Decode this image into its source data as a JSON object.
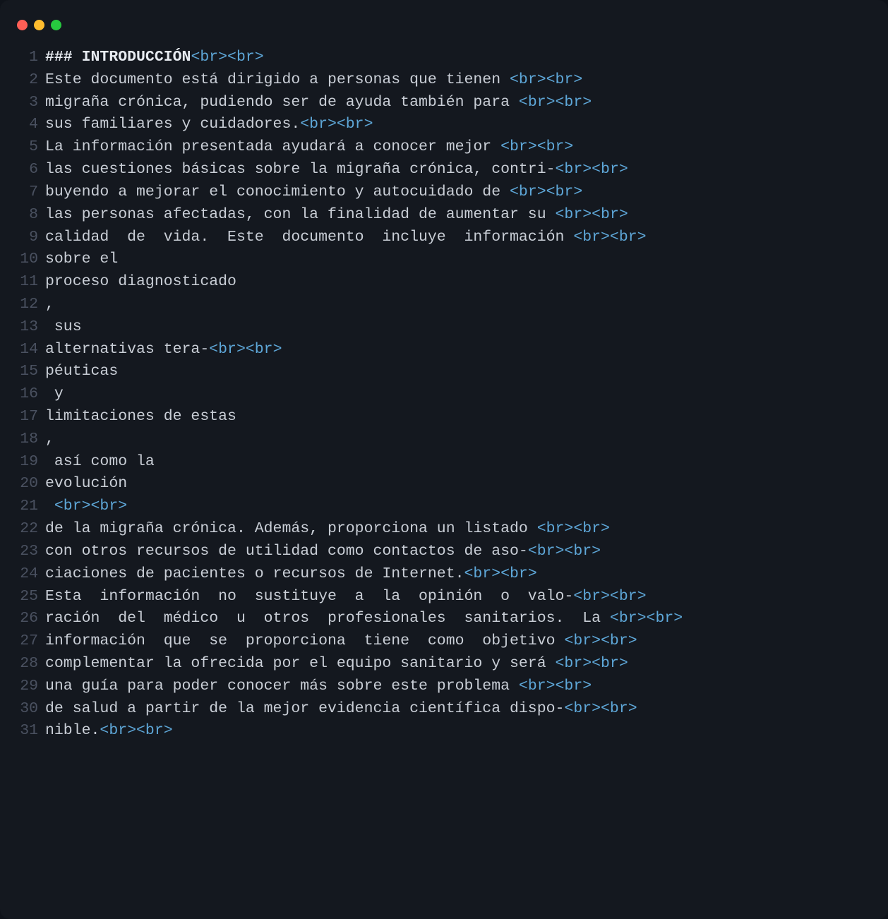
{
  "colors": {
    "bg": "#14181f",
    "outer_bg": "#0f131a",
    "text": "#c9ced6",
    "bold": "#e7ebf1",
    "tag": "#5ea7d8",
    "gutter": "#4a5160",
    "traffic_red": "#ff5f56",
    "traffic_yellow": "#ffbd2e",
    "traffic_green": "#27c93f"
  },
  "lines": [
    {
      "n": "1",
      "segs": [
        {
          "cls": "bold",
          "t": "### INTRODUCCIÓN"
        },
        {
          "cls": "tag",
          "t": "<br><br>"
        }
      ]
    },
    {
      "n": "2",
      "segs": [
        {
          "cls": "plain",
          "t": "Este documento está dirigido a personas que tienen "
        },
        {
          "cls": "tag",
          "t": "<br><br>"
        }
      ]
    },
    {
      "n": "3",
      "segs": [
        {
          "cls": "plain",
          "t": "migraña crónica, pudiendo ser de ayuda también para "
        },
        {
          "cls": "tag",
          "t": "<br><br>"
        }
      ]
    },
    {
      "n": "4",
      "segs": [
        {
          "cls": "plain",
          "t": "sus familiares y cuidadores."
        },
        {
          "cls": "tag",
          "t": "<br><br>"
        }
      ]
    },
    {
      "n": "5",
      "segs": [
        {
          "cls": "plain",
          "t": "La información presentada ayudará a conocer mejor "
        },
        {
          "cls": "tag",
          "t": "<br><br>"
        }
      ]
    },
    {
      "n": "6",
      "segs": [
        {
          "cls": "plain",
          "t": "las cuestiones básicas sobre la migraña crónica, contri-"
        },
        {
          "cls": "tag",
          "t": "<br><br>"
        }
      ]
    },
    {
      "n": "7",
      "segs": [
        {
          "cls": "plain",
          "t": "buyendo a mejorar el conocimiento y autocuidado de "
        },
        {
          "cls": "tag",
          "t": "<br><br>"
        }
      ]
    },
    {
      "n": "8",
      "segs": [
        {
          "cls": "plain",
          "t": "las personas afectadas, con la finalidad de aumentar su "
        },
        {
          "cls": "tag",
          "t": "<br><br>"
        }
      ]
    },
    {
      "n": "9",
      "segs": [
        {
          "cls": "plain",
          "t": "calidad  de  vida.  Este  documento  incluye  información "
        },
        {
          "cls": "tag",
          "t": "<br><br>"
        }
      ]
    },
    {
      "n": "10",
      "segs": [
        {
          "cls": "plain",
          "t": "sobre el"
        }
      ]
    },
    {
      "n": "11",
      "segs": [
        {
          "cls": "plain",
          "t": "proceso diagnosticado"
        }
      ]
    },
    {
      "n": "12",
      "segs": [
        {
          "cls": "plain",
          "t": ","
        }
      ]
    },
    {
      "n": "13",
      "segs": [
        {
          "cls": "plain",
          "t": " sus"
        }
      ]
    },
    {
      "n": "14",
      "segs": [
        {
          "cls": "plain",
          "t": "alternativas tera-"
        },
        {
          "cls": "tag",
          "t": "<br><br>"
        }
      ]
    },
    {
      "n": "15",
      "segs": [
        {
          "cls": "plain",
          "t": "péuticas"
        }
      ]
    },
    {
      "n": "16",
      "segs": [
        {
          "cls": "plain",
          "t": " y"
        }
      ]
    },
    {
      "n": "17",
      "segs": [
        {
          "cls": "plain",
          "t": "limitaciones de estas"
        }
      ]
    },
    {
      "n": "18",
      "segs": [
        {
          "cls": "plain",
          "t": ","
        }
      ]
    },
    {
      "n": "19",
      "segs": [
        {
          "cls": "plain",
          "t": " así como la"
        }
      ]
    },
    {
      "n": "20",
      "segs": [
        {
          "cls": "plain",
          "t": "evolución"
        }
      ]
    },
    {
      "n": "21",
      "segs": [
        {
          "cls": "plain",
          "t": " "
        },
        {
          "cls": "tag",
          "t": "<br><br>"
        }
      ]
    },
    {
      "n": "22",
      "segs": [
        {
          "cls": "plain",
          "t": "de la migraña crónica. Además, proporciona un listado "
        },
        {
          "cls": "tag",
          "t": "<br><br>"
        }
      ]
    },
    {
      "n": "23",
      "segs": [
        {
          "cls": "plain",
          "t": "con otros recursos de utilidad como contactos de aso-"
        },
        {
          "cls": "tag",
          "t": "<br><br>"
        }
      ]
    },
    {
      "n": "24",
      "segs": [
        {
          "cls": "plain",
          "t": "ciaciones de pacientes o recursos de Internet."
        },
        {
          "cls": "tag",
          "t": "<br><br>"
        }
      ]
    },
    {
      "n": "25",
      "segs": [
        {
          "cls": "plain",
          "t": "Esta  información  no  sustituye  a  la  opinión  o  valo-"
        },
        {
          "cls": "tag",
          "t": "<br><br>"
        }
      ]
    },
    {
      "n": "26",
      "segs": [
        {
          "cls": "plain",
          "t": "ración  del  médico  u  otros  profesionales  sanitarios.  La "
        },
        {
          "cls": "tag",
          "t": "<br><br>"
        }
      ]
    },
    {
      "n": "27",
      "segs": [
        {
          "cls": "plain",
          "t": "información  que  se  proporciona  tiene  como  objetivo "
        },
        {
          "cls": "tag",
          "t": "<br><br>"
        }
      ]
    },
    {
      "n": "28",
      "segs": [
        {
          "cls": "plain",
          "t": "complementar la ofrecida por el equipo sanitario y será "
        },
        {
          "cls": "tag",
          "t": "<br><br>"
        }
      ]
    },
    {
      "n": "29",
      "segs": [
        {
          "cls": "plain",
          "t": "una guía para poder conocer más sobre este problema "
        },
        {
          "cls": "tag",
          "t": "<br><br>"
        }
      ]
    },
    {
      "n": "30",
      "segs": [
        {
          "cls": "plain",
          "t": "de salud a partir de la mejor evidencia científica dispo-"
        },
        {
          "cls": "tag",
          "t": "<br><br>"
        }
      ]
    },
    {
      "n": "31",
      "segs": [
        {
          "cls": "plain",
          "t": "nible."
        },
        {
          "cls": "tag",
          "t": "<br><br>"
        }
      ]
    }
  ]
}
